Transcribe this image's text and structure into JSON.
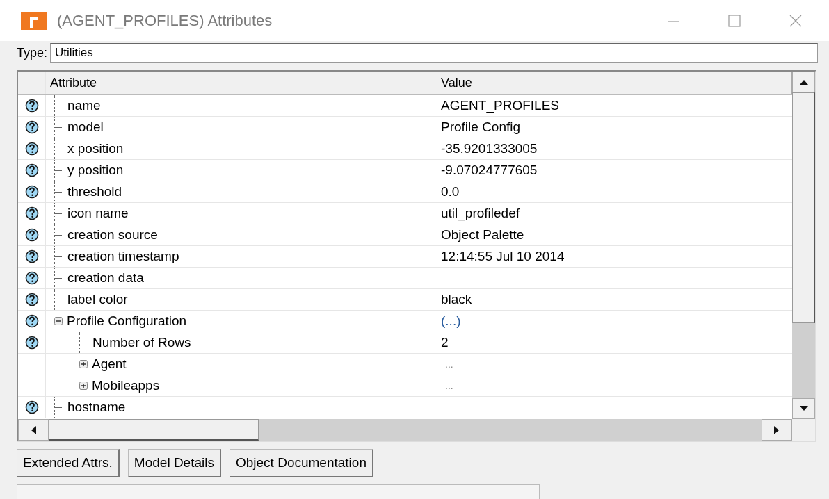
{
  "window": {
    "title": "(AGENT_PROFILES) Attributes"
  },
  "type_field": {
    "label": "Type:",
    "value": "Utilities"
  },
  "table": {
    "columns": [
      "Attribute",
      "Value"
    ],
    "rows": [
      {
        "name": "name",
        "value": "AGENT_PROFILES",
        "help": true
      },
      {
        "name": "model",
        "value": "Profile Config",
        "help": true
      },
      {
        "name": "x position",
        "value": "-35.9201333005",
        "help": true
      },
      {
        "name": "y position",
        "value": "-9.07024777605",
        "help": true
      },
      {
        "name": "threshold",
        "value": "0.0",
        "help": true
      },
      {
        "name": "icon name",
        "value": "util_profiledef",
        "help": true
      },
      {
        "name": "creation source",
        "value": "Object Palette",
        "help": true
      },
      {
        "name": "creation timestamp",
        "value": "12:14:55 Jul 10 2014",
        "help": true
      },
      {
        "name": "creation data",
        "help": true
      },
      {
        "name": "label color",
        "value": "black",
        "help": true
      },
      {
        "name": "Profile Configuration",
        "value": "(...)",
        "kind": "link",
        "help": true,
        "expanded": true,
        "children": [
          {
            "name": "Number of Rows",
            "value": "2",
            "help": true
          },
          {
            "name": "Agent",
            "value": "...",
            "kind": "placeholder",
            "help": false,
            "expanded": false
          },
          {
            "name": "Mobileapps",
            "value": "...",
            "kind": "placeholder",
            "help": false,
            "expanded": false
          }
        ]
      },
      {
        "name": "hostname",
        "help": true
      }
    ]
  },
  "buttons": [
    "Extended Attrs.",
    "Model Details",
    "Object Documentation"
  ]
}
